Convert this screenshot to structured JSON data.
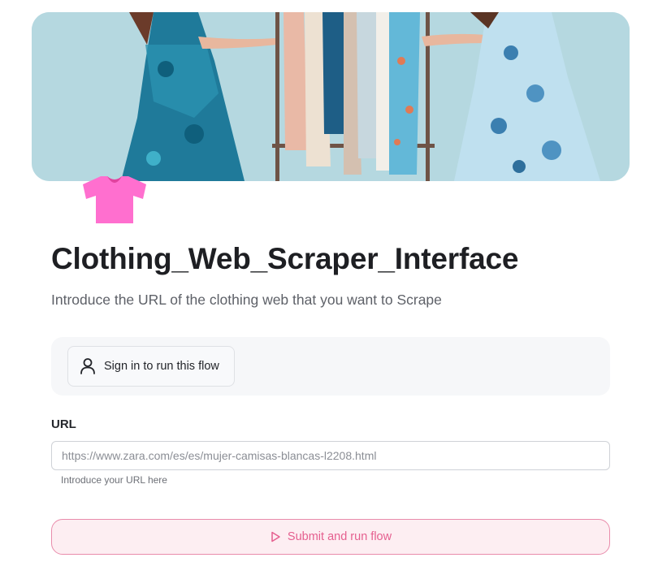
{
  "app": {
    "title": "Clothing_Web_Scraper_Interface",
    "description": "Introduce the URL of the clothing web that you want to Scrape",
    "icon": "t-shirt-icon",
    "banner": "clothing-rack-banner-image"
  },
  "signin": {
    "label": "Sign in to run this flow",
    "icon": "user-icon"
  },
  "form": {
    "url_label": "URL",
    "url_placeholder": "https://www.zara.com/es/es/mujer-camisas-blancas-l2208.html",
    "url_value": "",
    "url_help": "Introduce your URL here"
  },
  "submit": {
    "label": "Submit and run flow",
    "icon": "play-icon"
  },
  "colors": {
    "accent": "#e55f8f",
    "accent_bg": "#fdeef2",
    "accent_border": "#e98cab",
    "icon_pink": "#ff6fcf",
    "panel_bg": "#f6f7f9"
  }
}
